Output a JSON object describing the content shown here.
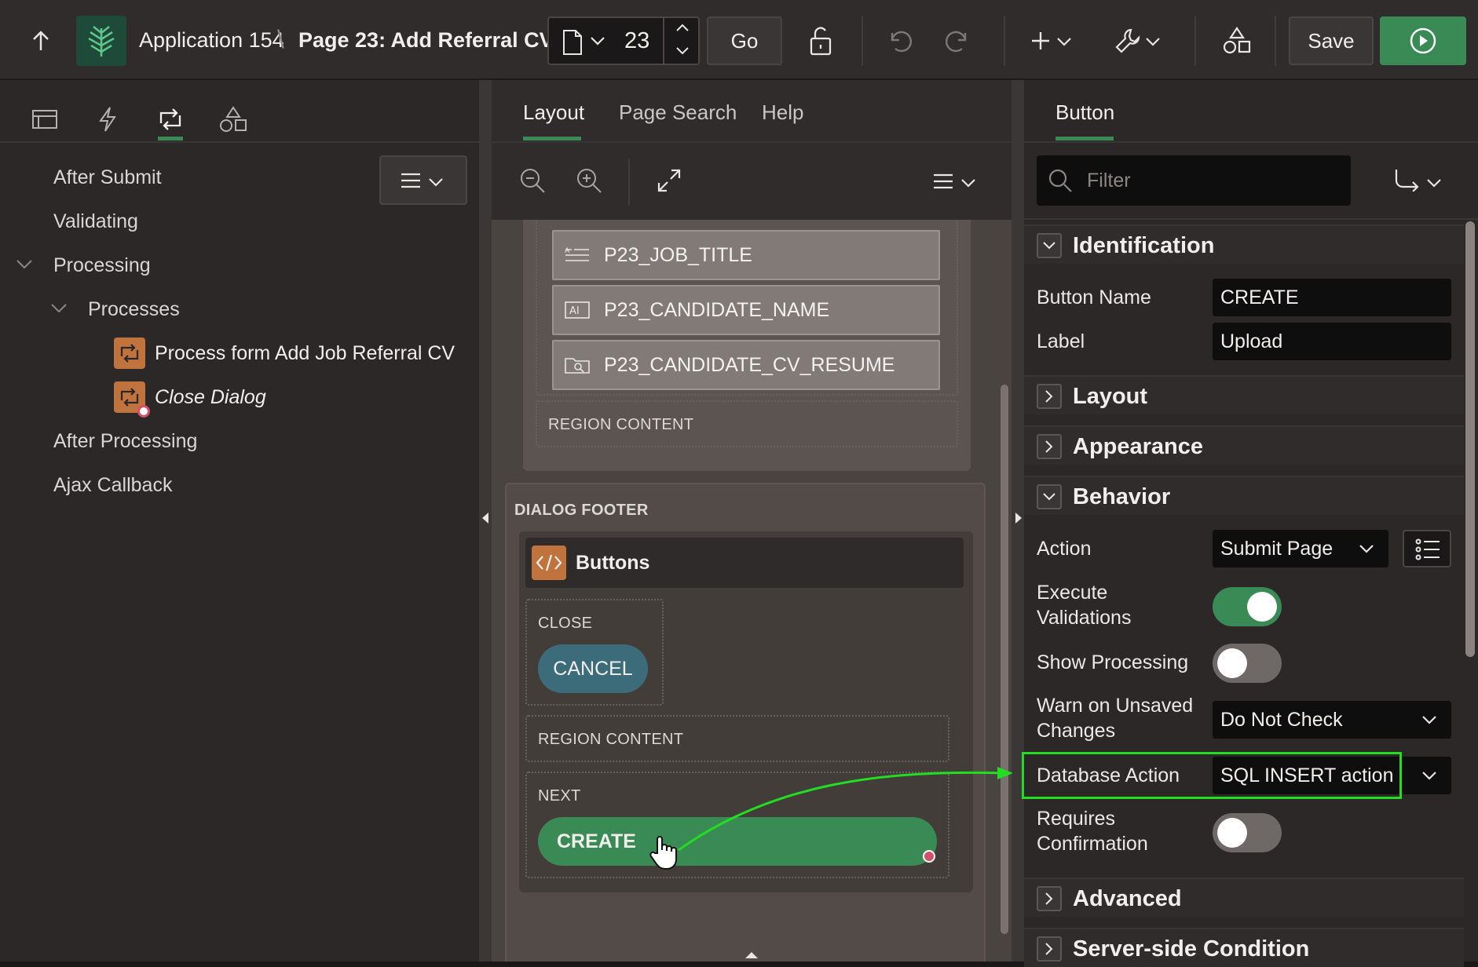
{
  "app": {
    "breadcrumb_app": "Application 154",
    "breadcrumb_sep": "\\",
    "breadcrumb_page": "Page 23: Add Referral CV",
    "page_number": "23",
    "go_label": "Go",
    "save_label": "Save"
  },
  "left_panel": {
    "tree": [
      {
        "label": "After Submit"
      },
      {
        "label": "Validating"
      },
      {
        "label": "Processing"
      },
      {
        "label": "Processes"
      },
      {
        "label": "Process form Add Job Referral CV"
      },
      {
        "label": "Close Dialog"
      },
      {
        "label": "After Processing"
      },
      {
        "label": "Ajax Callback"
      }
    ]
  },
  "center_panel": {
    "tabs": [
      "Layout",
      "Page Search",
      "Help"
    ],
    "fields": [
      "P23_JOB_TITLE",
      "P23_CANDIDATE_NAME",
      "P23_CANDIDATE_CV_RESUME"
    ],
    "region_content_1": "REGION CONTENT",
    "dialog_footer": "DIALOG FOOTER",
    "buttons_region": "Buttons",
    "close_position": "CLOSE",
    "cancel_button": "CANCEL",
    "region_content_2": "REGION CONTENT",
    "next_position": "NEXT",
    "create_button": "CREATE"
  },
  "right_panel": {
    "tab": "Button",
    "filter_placeholder": "Filter",
    "sections": {
      "identification": "Identification",
      "layout": "Layout",
      "appearance": "Appearance",
      "behavior": "Behavior",
      "advanced": "Advanced",
      "server_side": "Server-side Condition"
    },
    "identification": {
      "button_name_label": "Button Name",
      "button_name_value": "CREATE",
      "label_label": "Label",
      "label_value": "Upload"
    },
    "behavior": {
      "action_label": "Action",
      "action_value": "Submit Page",
      "exec_valid_label_1": "Execute",
      "exec_valid_label_2": "Validations",
      "execute_validations_on": true,
      "show_processing_label": "Show Processing",
      "show_processing_on": false,
      "warn_label_1": "Warn on Unsaved",
      "warn_label_2": "Changes",
      "warn_value": "Do Not Check",
      "db_action_label": "Database Action",
      "db_action_value": "SQL INSERT action",
      "req_conf_label_1": "Requires",
      "req_conf_label_2": "Confirmation",
      "requires_confirmation_on": false
    }
  },
  "colors": {
    "accent_green": "#3a8a55",
    "highlight_green": "#22dd22",
    "cancel_teal": "#3c6c7a",
    "process_orange": "#c0733d"
  }
}
